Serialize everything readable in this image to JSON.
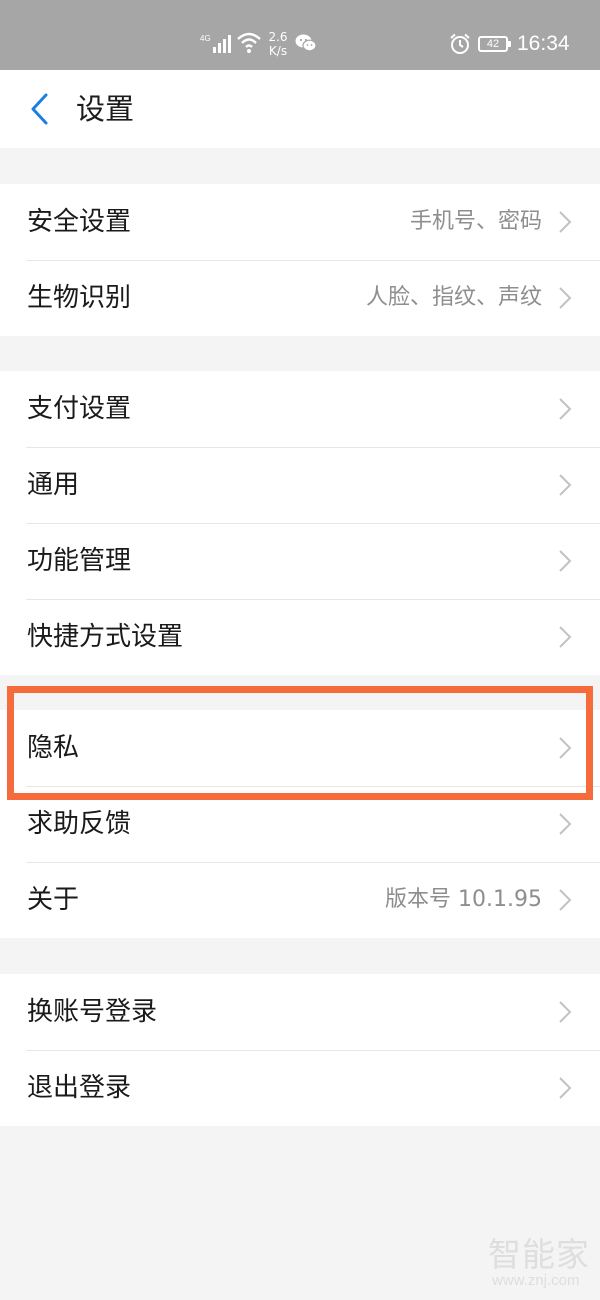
{
  "status_bar": {
    "network_label": "4G",
    "speed_value": "2.6",
    "speed_unit": "K/s",
    "battery_level": "42",
    "time": "16:34",
    "icons": [
      "signal-icon",
      "wifi-icon",
      "wechat-icon",
      "alarm-icon",
      "battery-icon"
    ]
  },
  "header": {
    "title": "设置",
    "back_icon": "chevron-left-icon"
  },
  "groups": [
    {
      "items": [
        {
          "label": "安全设置",
          "value": "手机号、密码"
        },
        {
          "label": "生物识别",
          "value": "人脸、指纹、声纹"
        }
      ]
    },
    {
      "items": [
        {
          "label": "支付设置",
          "value": ""
        },
        {
          "label": "通用",
          "value": ""
        },
        {
          "label": "功能管理",
          "value": ""
        },
        {
          "label": "快捷方式设置",
          "value": ""
        }
      ]
    },
    {
      "items": [
        {
          "label": "隐私",
          "value": ""
        },
        {
          "label": "求助反馈",
          "value": ""
        },
        {
          "label": "关于",
          "value": "版本号 10.1.95"
        }
      ]
    },
    {
      "items": [
        {
          "label": "换账号登录",
          "value": ""
        },
        {
          "label": "退出登录",
          "value": ""
        }
      ]
    }
  ],
  "highlight": {
    "target": "隐私",
    "color": "#f56b3b"
  },
  "watermark": {
    "text": "智能家",
    "url": "www.znj.com"
  },
  "colors": {
    "status_bar_bg": "#a6a6a6",
    "page_bg": "#f4f4f4",
    "accent_blue": "#1b7fe0",
    "secondary_text": "#8e8e8e"
  }
}
